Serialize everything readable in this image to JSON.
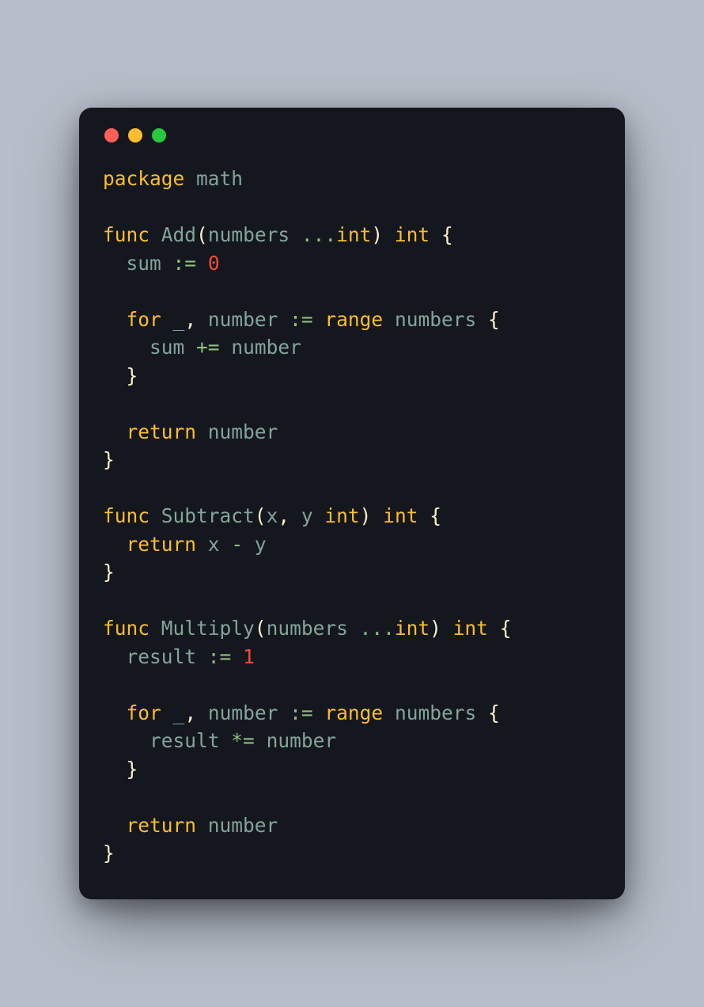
{
  "colors": {
    "background_page": "#b6bec9",
    "background_window": "#15171f",
    "dot_red": "#ff5f56",
    "dot_yellow": "#ffbd2e",
    "dot_green": "#27c93f",
    "keyword": "#fabd2f",
    "identifier": "#83a598",
    "operator": "#8ec07c",
    "number": "#fb4934",
    "default": "#fbf1c7"
  },
  "language": "go",
  "tokens": {
    "package": "package",
    "math": "math",
    "func": "func",
    "Add": "Add",
    "numbers": "numbers",
    "dots": "...",
    "int": "int",
    "sum": "sum",
    "assign": ":=",
    "zero": "0",
    "for": "for",
    "underscore": "_",
    "number": "number",
    "range": "range",
    "plusEq": "+=",
    "return": "return",
    "Subtract": "Subtract",
    "x": "x",
    "y": "y",
    "minus": "-",
    "Multiply": "Multiply",
    "result": "result",
    "one": "1",
    "starEq": "*=",
    "lp": "(",
    "rp": ")",
    "lb": "{",
    "rb": "}",
    "comma": ","
  }
}
